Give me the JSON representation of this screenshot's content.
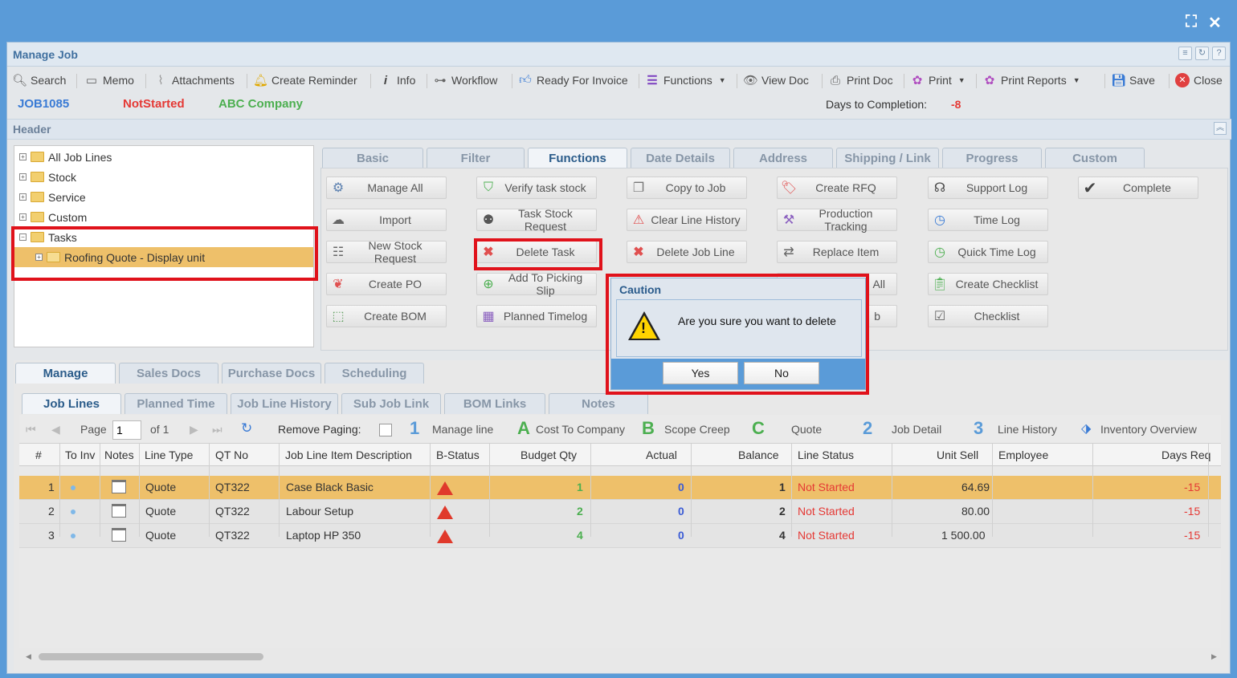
{
  "window": {
    "title": "Manage Job"
  },
  "toolbar": [
    {
      "label": "Search",
      "icon": "search-icon"
    },
    {
      "label": "Memo",
      "icon": "memo-icon"
    },
    {
      "label": "Attachments",
      "icon": "paperclip-icon"
    },
    {
      "label": "Create Reminder",
      "icon": "bell-icon"
    },
    {
      "label": "Info",
      "icon": "info-icon"
    },
    {
      "label": "Workflow",
      "icon": "workflow-icon"
    },
    {
      "label": "Ready For Invoice",
      "icon": "thumbs-up-icon"
    },
    {
      "label": "Functions",
      "icon": "menu-icon"
    },
    {
      "label": "View Doc",
      "icon": "eye-icon"
    },
    {
      "label": "Print Doc",
      "icon": "printer-icon"
    },
    {
      "label": "Print",
      "icon": "palette-icon"
    },
    {
      "label": "Print Reports",
      "icon": "palette-icon"
    },
    {
      "label": "Save",
      "icon": "save-icon"
    },
    {
      "label": "Close",
      "icon": "close-icon"
    }
  ],
  "job": {
    "number": "JOB1085",
    "status": "NotStarted",
    "company": "ABC Company",
    "days_label": "Days to Completion:",
    "days_value": "-8"
  },
  "header": {
    "title": "Header"
  },
  "tree": [
    {
      "label": "All Job Lines",
      "expanded": false
    },
    {
      "label": "Stock",
      "expanded": false
    },
    {
      "label": "Service",
      "expanded": false
    },
    {
      "label": "Custom",
      "expanded": false
    },
    {
      "label": "Tasks",
      "expanded": true
    },
    {
      "label": "Roofing Quote - Display unit",
      "expanded": false,
      "selected": true
    }
  ],
  "fn_tabs": [
    "Basic",
    "Filter",
    "Functions",
    "Date Details",
    "Address",
    "Shipping / Link",
    "Progress",
    "Custom"
  ],
  "fn_buttons": {
    "manage_all": "Manage All",
    "import": "Import",
    "new_stock_request": "New Stock Request",
    "create_po": "Create PO",
    "create_bom": "Create BOM",
    "verify_task_stock": "Verify task stock",
    "task_stock_request": "Task Stock Request",
    "delete_task": "Delete Task",
    "add_to_picking_slip": "Add To Picking Slip",
    "planned_timelog": "Planned Timelog",
    "copy_to_job": "Copy to Job",
    "clear_line_history": "Clear Line History",
    "delete_job_line": "Delete Job Line",
    "create_rfq": "Create RFQ",
    "production_tracking": "Production Tracking",
    "replace_item": "Replace Item",
    "hidden_4": "All",
    "hidden_5": "b",
    "support_log": "Support Log",
    "time_log": "Time Log",
    "quick_time_log": "Quick Time Log",
    "create_checklist": "Create Checklist",
    "checklist": "Checklist",
    "complete": "Complete"
  },
  "bottom_tabs": [
    "Manage",
    "Sales Docs",
    "Purchase Docs",
    "Scheduling"
  ],
  "sub_tabs": [
    "Job Lines",
    "Planned Time",
    "Job Line History",
    "Sub Job Link",
    "BOM Links",
    "Notes"
  ],
  "pager": {
    "page_label": "Page",
    "page_value": "1",
    "of_label": "of 1",
    "remove_paging": "Remove Paging:",
    "legend": [
      {
        "key": "1",
        "label": "Manage line"
      },
      {
        "key": "A",
        "label": "Cost To Company"
      },
      {
        "key": "B",
        "label": "Scope Creep"
      },
      {
        "key": "C",
        "label": "Quote"
      },
      {
        "key": "2",
        "label": "Job Detail"
      },
      {
        "key": "3",
        "label": "Line History"
      }
    ],
    "inventory_overview": "Inventory Overview"
  },
  "grid": {
    "columns": [
      "#",
      "To Inv",
      "Notes",
      "Line Type",
      "QT No",
      "Job Line Item Description",
      "B-Status",
      "Budget Qty",
      "Actual",
      "Balance",
      "Line Status",
      "Unit Sell",
      "Employee",
      "Days Req"
    ],
    "rows": [
      {
        "n": "1",
        "type": "Quote",
        "qt": "QT322",
        "desc": "Case Black Basic",
        "budget": "1",
        "actual": "0",
        "balance": "1",
        "status": "Not Started",
        "unit": "64.69",
        "employee": "",
        "days": "-15"
      },
      {
        "n": "2",
        "type": "Quote",
        "qt": "QT322",
        "desc": "Labour Setup",
        "budget": "2",
        "actual": "0",
        "balance": "2",
        "status": "Not Started",
        "unit": "80.00",
        "employee": "",
        "days": "-15"
      },
      {
        "n": "3",
        "type": "Quote",
        "qt": "QT322",
        "desc": "Laptop HP 350",
        "budget": "4",
        "actual": "0",
        "balance": "4",
        "status": "Not Started",
        "unit": "1 500.00",
        "employee": "",
        "days": "-15"
      }
    ]
  },
  "dialog": {
    "title": "Caution",
    "message": "Are you sure you want to delete",
    "yes": "Yes",
    "no": "No"
  },
  "colors": {
    "accent": "#5a9bd8",
    "status_red": "#e53935",
    "company_green": "#4caf50",
    "job_blue": "#3a7bd5",
    "highlight": "#e0121b"
  }
}
